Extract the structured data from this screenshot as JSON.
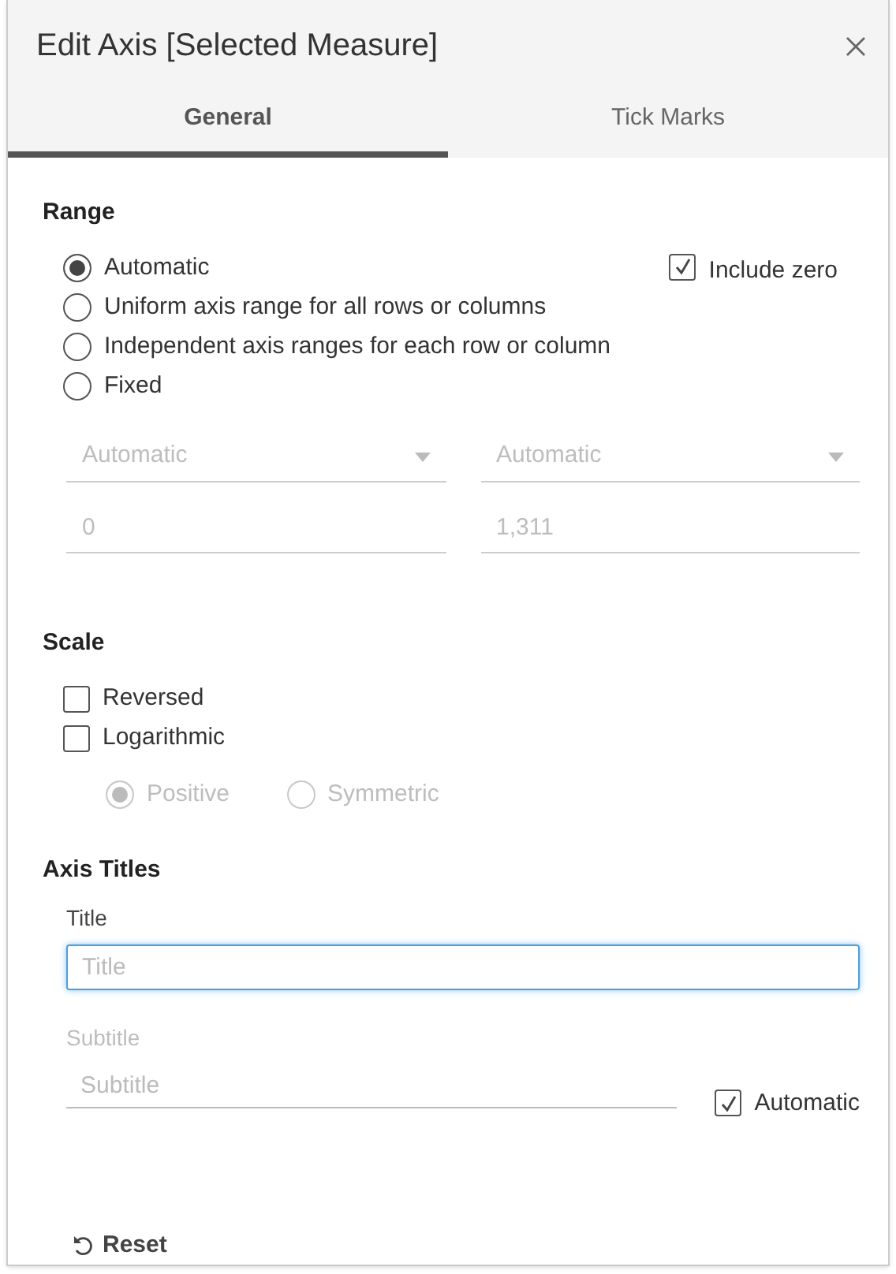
{
  "dialog": {
    "title": "Edit Axis [Selected Measure]"
  },
  "tabs": [
    {
      "label": "General",
      "selected": true
    },
    {
      "label": "Tick Marks",
      "selected": false
    }
  ],
  "range": {
    "heading": "Range",
    "options": [
      {
        "label": "Automatic",
        "selected": true
      },
      {
        "label": "Uniform axis range for all rows or columns",
        "selected": false
      },
      {
        "label": "Independent axis ranges for each row or column",
        "selected": false
      },
      {
        "label": "Fixed",
        "selected": false
      }
    ],
    "include_zero": {
      "label": "Include zero",
      "checked": true
    },
    "dropdowns": [
      {
        "value": "Automatic",
        "disabled": true
      },
      {
        "value": "Automatic",
        "disabled": true
      }
    ],
    "fields": [
      {
        "value": "0",
        "disabled": true
      },
      {
        "value": "1,311",
        "disabled": true
      }
    ]
  },
  "scale": {
    "heading": "Scale",
    "checks": [
      {
        "label": "Reversed",
        "checked": false
      },
      {
        "label": "Logarithmic",
        "checked": false
      }
    ],
    "log_options": [
      {
        "label": "Positive",
        "selected": true,
        "disabled": true
      },
      {
        "label": "Symmetric",
        "selected": false,
        "disabled": true
      }
    ]
  },
  "axis_titles": {
    "heading": "Axis Titles",
    "title": {
      "label": "Title",
      "placeholder": "Title",
      "focused": true
    },
    "subtitle": {
      "label": "Subtitle",
      "placeholder": "Subtitle",
      "disabled": true
    },
    "automatic": {
      "label": "Automatic",
      "checked": true
    }
  },
  "reset": {
    "label": "Reset"
  }
}
